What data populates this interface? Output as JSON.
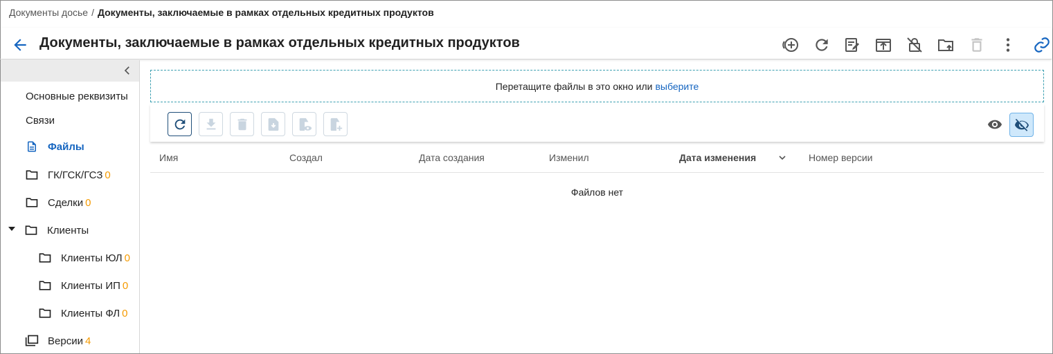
{
  "breadcrumb": {
    "parent": "Документы досье",
    "separator": "/",
    "current": "Документы, заключаемые в рамках отдельных кредитных продуктов"
  },
  "header": {
    "title": "Документы, заключаемые в рамках отдельных кредитных продуктов",
    "actions": [
      "add-circle-icon",
      "refresh-icon",
      "edit-document-icon",
      "upload-box-icon",
      "unlock-off-icon",
      "folder-upload-icon",
      "delete-icon",
      "more-vert-icon",
      "link-icon"
    ]
  },
  "sidebar": {
    "items": [
      {
        "label": "Основные реквизиты"
      },
      {
        "label": "Связи"
      },
      {
        "label": "Файлы"
      },
      {
        "label": "ГК/ГСК/ГСЗ",
        "count": "0"
      },
      {
        "label": "Сделки",
        "count": "0"
      },
      {
        "label": "Клиенты"
      },
      {
        "label": "Клиенты ЮЛ",
        "count": "0"
      },
      {
        "label": "Клиенты ИП",
        "count": "0"
      },
      {
        "label": "Клиенты ФЛ",
        "count": "0"
      },
      {
        "label": "Версии",
        "count": "4"
      }
    ]
  },
  "dropzone": {
    "text": "Перетащите файлы в это окно или",
    "link": "выберите"
  },
  "table": {
    "columns": [
      "Имя",
      "Создал",
      "Дата создания",
      "Изменил",
      "Дата изменения",
      "Номер версии"
    ],
    "sorted_column": "Дата изменения",
    "empty_message": "Файлов нет"
  },
  "colors": {
    "accent": "#1565c0",
    "count": "#f59a00",
    "primary_border": "#1f4e79"
  }
}
